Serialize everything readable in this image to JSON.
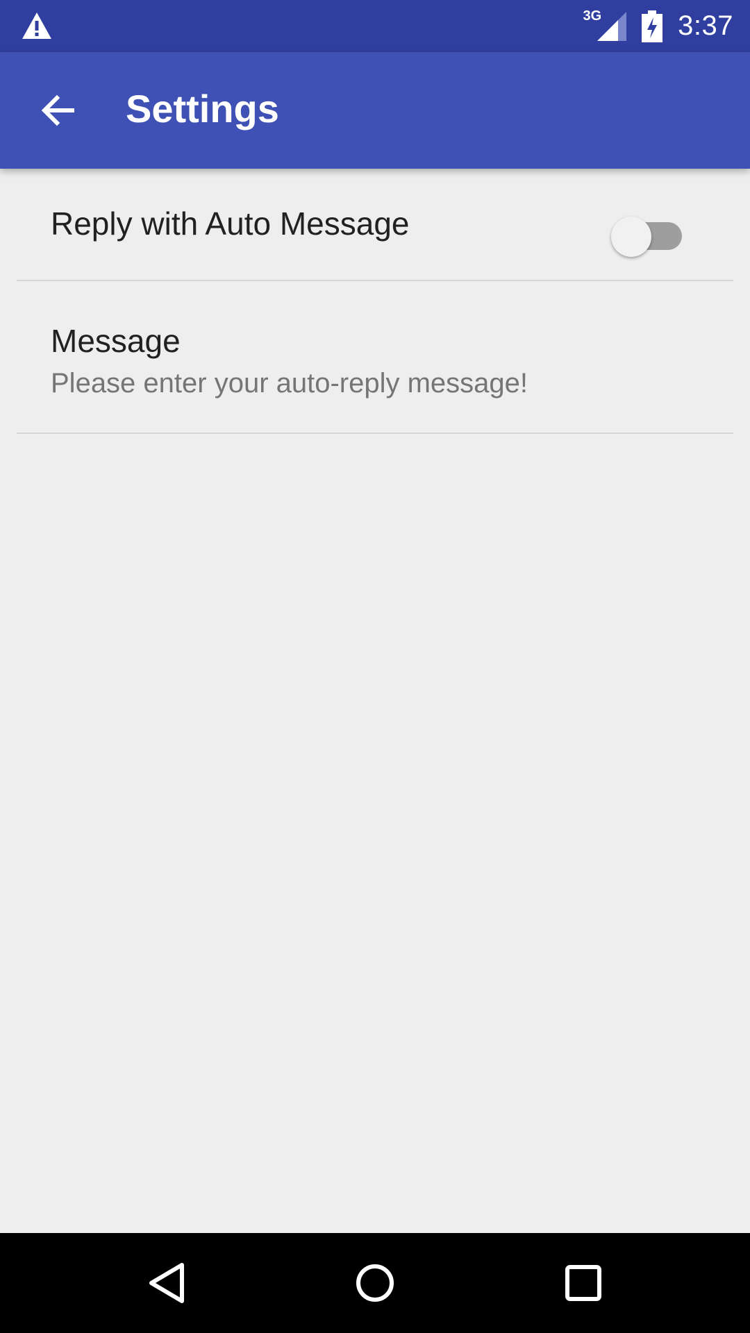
{
  "status_bar": {
    "network_label": "3G",
    "time": "3:37",
    "icons": [
      "warning-icon",
      "signal-icon",
      "battery-charging-icon"
    ]
  },
  "app_bar": {
    "title": "Settings",
    "back_icon": "arrow-back-icon"
  },
  "preferences": {
    "auto_reply": {
      "label": "Reply with Auto Message",
      "enabled": false
    },
    "message": {
      "title": "Message",
      "summary": "Please enter your auto-reply message!"
    }
  },
  "nav_bar": {
    "icons": [
      "back-triangle-icon",
      "home-circle-icon",
      "recents-square-icon"
    ]
  },
  "colors": {
    "status_bar": "#303f9f",
    "app_bar": "#3f51b5",
    "background": "#eeeeee",
    "switch_track_off": "#9e9e9e",
    "switch_thumb_off": "#f1f1f1"
  }
}
